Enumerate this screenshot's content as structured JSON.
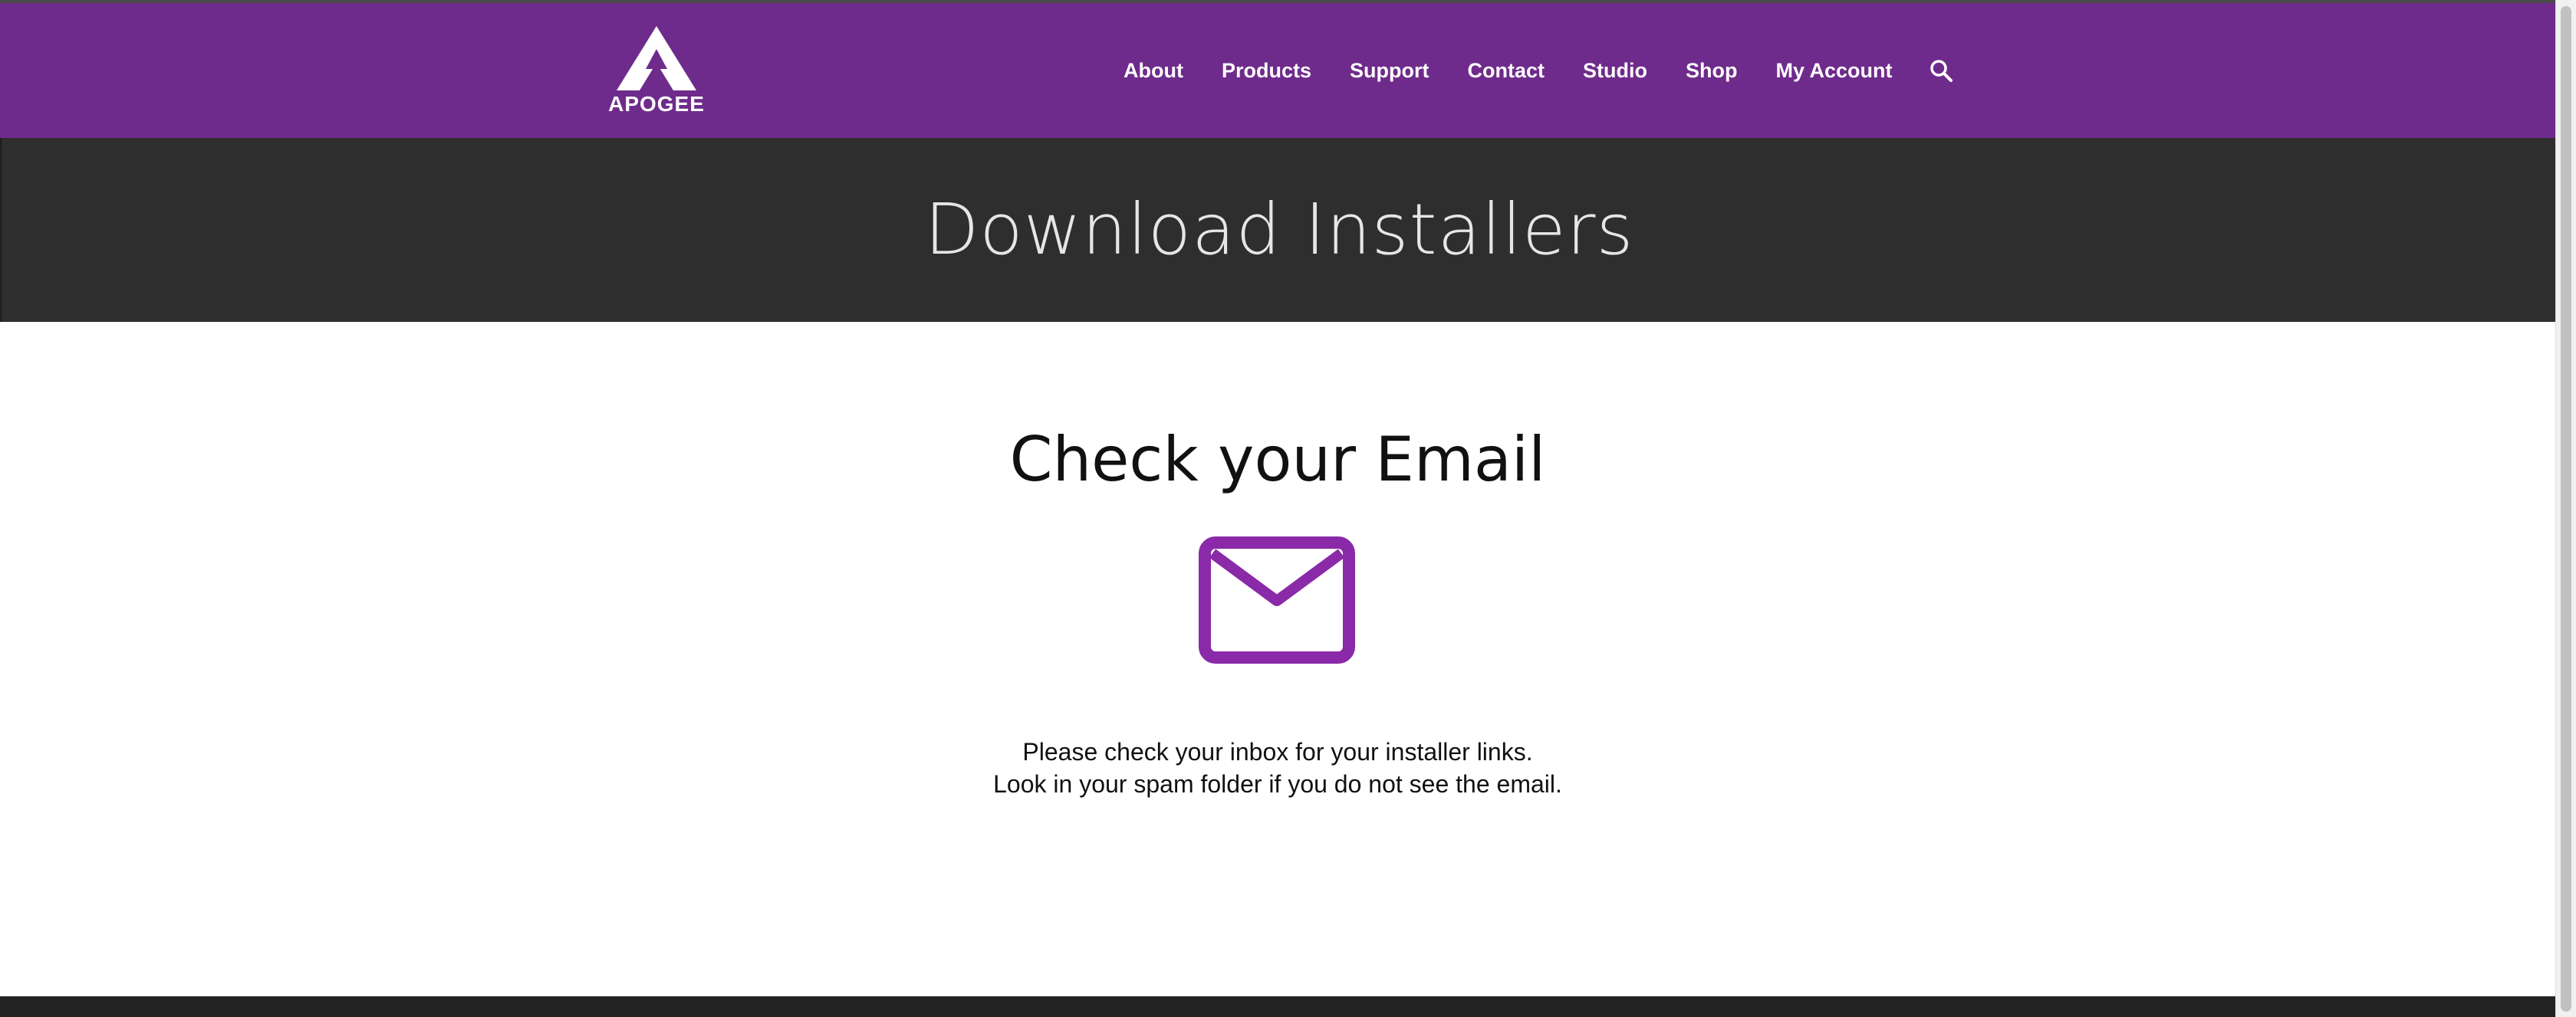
{
  "header": {
    "logo_text": "APOGEE",
    "nav": [
      {
        "label": "About"
      },
      {
        "label": "Products"
      },
      {
        "label": "Support"
      },
      {
        "label": "Contact"
      },
      {
        "label": "Studio"
      },
      {
        "label": "Shop"
      },
      {
        "label": "My Account"
      }
    ],
    "search_icon": "search-icon"
  },
  "title_band": {
    "title": "Download Installers"
  },
  "main": {
    "heading": "Check your Email",
    "icon": "envelope-icon",
    "message_lines": [
      "Please check your inbox for your installer links.",
      "Look in your spam folder if you do not see the email."
    ]
  },
  "colors": {
    "header_bg": "#6e2b8b",
    "title_band_bg": "#2e2e2e",
    "envelope": "#8a2aa8",
    "footer_bg": "#232323"
  }
}
